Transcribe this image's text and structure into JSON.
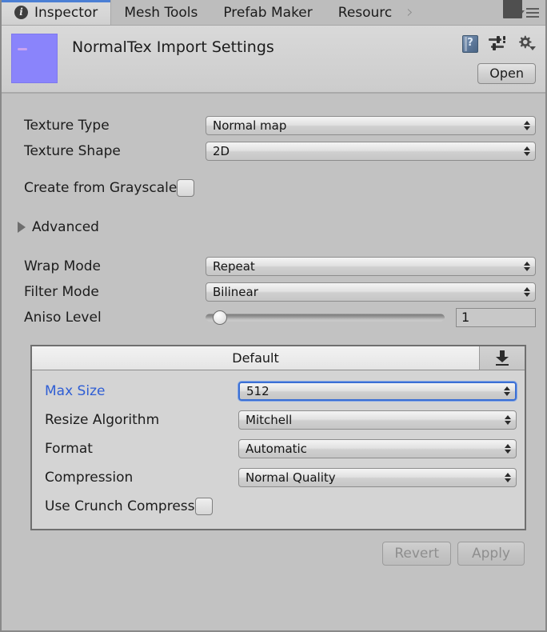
{
  "window": {
    "tabs": [
      {
        "label": "Inspector",
        "icon": "info-icon",
        "active": true
      },
      {
        "label": "Mesh Tools",
        "active": false
      },
      {
        "label": "Prefab Maker",
        "active": false
      },
      {
        "label": "Resourc",
        "active": false
      }
    ],
    "overflow_chevron": "›",
    "lock_icon": "lock-icon",
    "menu_icon": "hamburger-menu-icon"
  },
  "header": {
    "title": "NormalTex Import Settings",
    "thumbnail_color": "#8a84fb",
    "help_icon": "help-book-icon",
    "preset_icon": "preset-sliders-icon",
    "gear_icon": "gear-icon",
    "open_label": "Open"
  },
  "main": {
    "texture_type": {
      "label": "Texture Type",
      "value": "Normal map"
    },
    "texture_shape": {
      "label": "Texture Shape",
      "value": "2D"
    },
    "create_from_grayscale": {
      "label": "Create from Grayscale",
      "checked": false
    },
    "advanced": {
      "label": "Advanced",
      "expanded": false
    },
    "wrap_mode": {
      "label": "Wrap Mode",
      "value": "Repeat"
    },
    "filter_mode": {
      "label": "Filter Mode",
      "value": "Bilinear"
    },
    "aniso_level": {
      "label": "Aniso Level",
      "value": "1",
      "min": 0,
      "max": 16,
      "percent": 6
    }
  },
  "platform": {
    "tab_label": "Default",
    "download_icon": "download-icon",
    "max_size": {
      "label": "Max Size",
      "value": "512",
      "highlighted": true,
      "focused": true
    },
    "resize_algorithm": {
      "label": "Resize Algorithm",
      "value": "Mitchell"
    },
    "format": {
      "label": "Format",
      "value": "Automatic"
    },
    "compression": {
      "label": "Compression",
      "value": "Normal Quality"
    },
    "use_crunch_compression": {
      "label": "Use Crunch Compress",
      "checked": false
    }
  },
  "footer": {
    "revert_label": "Revert",
    "apply_label": "Apply",
    "disabled": true
  },
  "colors": {
    "window_background": "#c2c2c2",
    "accent_blue": "#2f5ed4",
    "tab_accent": "#4b7fd4",
    "box_background": "#d4d4d4"
  }
}
